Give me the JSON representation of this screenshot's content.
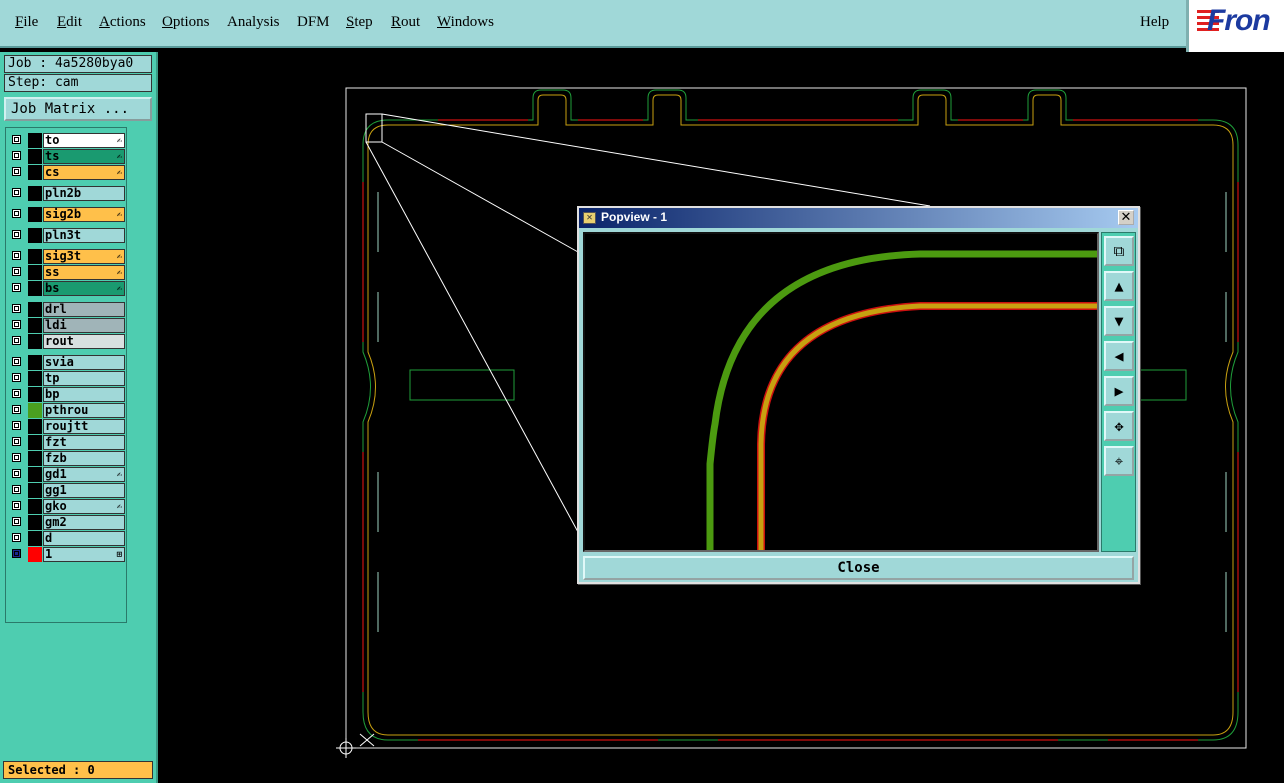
{
  "menu": {
    "items": [
      "File",
      "Edit",
      "Actions",
      "Options",
      "Analysis",
      "DFM",
      "Step",
      "Rout",
      "Windows"
    ],
    "underlined": [
      "F",
      "E",
      "A",
      "O",
      "",
      "",
      "S",
      "R",
      "W"
    ],
    "help": "Help"
  },
  "logo_text": "Fron",
  "job": {
    "label": "Job : 4a5280bya0",
    "step": "Step: cam"
  },
  "job_matrix_label": "Job Matrix ...",
  "layers": [
    {
      "name": "to",
      "color": "#ffffff",
      "swatch": "#000000",
      "flag": "✍"
    },
    {
      "name": "ts",
      "color": "#1a9a70",
      "swatch": "#000000",
      "flag": "✍"
    },
    {
      "name": "cs",
      "color": "#ffc04a",
      "swatch": "#000000",
      "flag": "✍"
    },
    {
      "name": "pln2b",
      "color": "#a0d8d8",
      "swatch": "#000000",
      "flag": ""
    },
    {
      "name": "sig2b",
      "color": "#ffc04a",
      "swatch": "#000000",
      "flag": "✍"
    },
    {
      "name": "pln3t",
      "color": "#a0d8d8",
      "swatch": "#000000",
      "flag": ""
    },
    {
      "name": "sig3t",
      "color": "#ffc04a",
      "swatch": "#000000",
      "flag": "✍"
    },
    {
      "name": "ss",
      "color": "#ffc04a",
      "swatch": "#000000",
      "flag": "✍"
    },
    {
      "name": "bs",
      "color": "#1a9a70",
      "swatch": "#000000",
      "flag": "✍"
    },
    {
      "name": "drl",
      "color": "#a0b4b8",
      "swatch": "#000000",
      "flag": ""
    },
    {
      "name": "ldi",
      "color": "#a0b4b8",
      "swatch": "#000000",
      "flag": ""
    },
    {
      "name": "rout",
      "color": "#d8e0e0",
      "swatch": "#000000",
      "flag": ""
    },
    {
      "name": "svia",
      "color": "#a0d8d8",
      "swatch": "#000000",
      "flag": ""
    },
    {
      "name": "tp",
      "color": "#a0d8d8",
      "swatch": "#000000",
      "flag": ""
    },
    {
      "name": "bp",
      "color": "#a0d8d8",
      "swatch": "#000000",
      "flag": ""
    },
    {
      "name": "pthrou",
      "color": "#a0d8d8",
      "swatch": "#4aa020",
      "flag": ""
    },
    {
      "name": "roujtt",
      "color": "#a0d8d8",
      "swatch": "#000000",
      "flag": ""
    },
    {
      "name": "fzt",
      "color": "#a0d8d8",
      "swatch": "#000000",
      "flag": ""
    },
    {
      "name": "fzb",
      "color": "#a0d8d8",
      "swatch": "#000000",
      "flag": ""
    },
    {
      "name": "gd1",
      "color": "#a0d8d8",
      "swatch": "#000000",
      "flag": "✍"
    },
    {
      "name": "gg1",
      "color": "#a0d8d8",
      "swatch": "#000000",
      "flag": ""
    },
    {
      "name": "gko",
      "color": "#a0d8d8",
      "swatch": "#000000",
      "flag": "✍"
    },
    {
      "name": "gm2",
      "color": "#a0d8d8",
      "swatch": "#000000",
      "flag": ""
    },
    {
      "name": "d",
      "color": "#a0d8d8",
      "swatch": "#000000",
      "flag": ""
    },
    {
      "name": "1",
      "color": "#a0d8d8",
      "swatch": "#ff0000",
      "flag": "⊞"
    }
  ],
  "selected": "Selected : 0",
  "popview": {
    "title": "Popview - 1",
    "close_label": "Close",
    "tools": [
      "zoom-fit-icon",
      "pan-up-icon",
      "pan-down-icon",
      "pan-left-icon",
      "pan-right-icon",
      "zoom-in-icon",
      "zoom-out-icon"
    ]
  },
  "colors": {
    "board_outline": "#1f9e3a",
    "route_red": "#cc1010",
    "trace_green": "#4c9a10",
    "trace_gold": "#c8a010"
  }
}
